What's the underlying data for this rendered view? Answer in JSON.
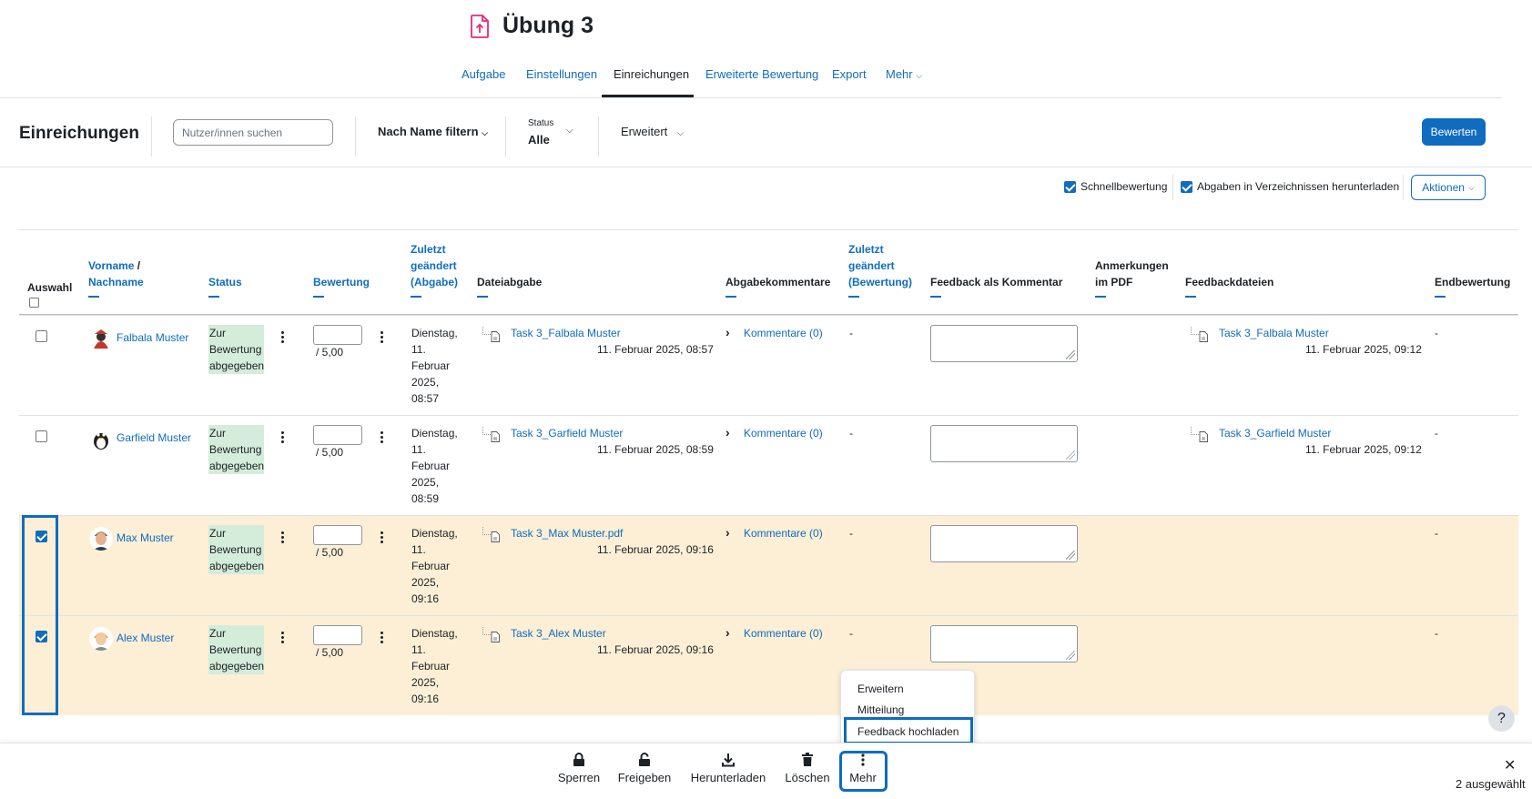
{
  "page": {
    "title": "Übung 3"
  },
  "nav_tabs": [
    "Aufgabe",
    "Einstellungen",
    "Einreichungen",
    "Erweiterte Bewertung",
    "Export",
    "Mehr"
  ],
  "toolbar": {
    "heading": "Einreichungen",
    "search_placeholder": "Nutzer/innen suchen",
    "name_filter": "Nach Name filtern",
    "status_label": "Status",
    "status_value": "Alle",
    "advanced": "Erweitert",
    "grade_button": "Bewerten"
  },
  "options": {
    "quick_grading": "Schnellbewertung",
    "download_in_folders": "Abgaben in Verzeichnissen herunterladen",
    "actions": "Aktionen"
  },
  "table": {
    "headers": {
      "select": "Auswahl",
      "firstname": "Vorname",
      "lastname": "Nachname",
      "status": "Status",
      "grade": "Bewertung",
      "last_modified_submission": [
        "Zuletzt",
        "geändert",
        "(Abgabe)"
      ],
      "file_submission": "Dateiabgabe",
      "submission_comments": "Abgabekommentare",
      "last_modified_grade": [
        "Zuletzt",
        "geändert",
        "(Bewertung)"
      ],
      "feedback_comment": "Feedback als Kommentar",
      "pdf_annotations": [
        "Anmerkungen",
        "im PDF"
      ],
      "feedback_files": "Feedbackdateien",
      "final_grade": "Endbewertung"
    },
    "rows": [
      {
        "name": "Falbala Muster",
        "selected": false,
        "status": [
          "Zur",
          "Bewertung",
          "abgegeben"
        ],
        "grade_outof": "/ 5,00",
        "modified": [
          "Dienstag,",
          "11.",
          "Februar",
          "2025,",
          "08:57"
        ],
        "file_name": "Task 3_Falbala Muster",
        "file_date": "11. Februar 2025, 08:57",
        "comments": "Kommentare (0)",
        "modified_grade": "-",
        "feedback_file": "Task 3_Falbala Muster",
        "feedback_file_date": "11. Februar 2025, 09:12",
        "final_grade": "-"
      },
      {
        "name": "Garfield Muster",
        "selected": false,
        "status": [
          "Zur",
          "Bewertung",
          "abgegeben"
        ],
        "grade_outof": "/ 5,00",
        "modified": [
          "Dienstag,",
          "11.",
          "Februar",
          "2025,",
          "08:59"
        ],
        "file_name": "Task 3_Garfield Muster",
        "file_date": "11. Februar 2025, 08:59",
        "comments": "Kommentare (0)",
        "modified_grade": "-",
        "feedback_file": "Task 3_Garfield Muster",
        "feedback_file_date": "11. Februar 2025, 09:12",
        "final_grade": "-"
      },
      {
        "name": "Max Muster",
        "selected": true,
        "status": [
          "Zur",
          "Bewertung",
          "abgegeben"
        ],
        "grade_outof": "/ 5,00",
        "modified": [
          "Dienstag,",
          "11.",
          "Februar",
          "2025,",
          "09:16"
        ],
        "file_name": "Task 3_Max Muster.pdf",
        "file_date": "11. Februar 2025, 09:16",
        "comments": "Kommentare (0)",
        "modified_grade": "-",
        "feedback_file": "",
        "feedback_file_date": "",
        "final_grade": "-"
      },
      {
        "name": "Alex Muster",
        "selected": true,
        "status": [
          "Zur",
          "Bewertung",
          "abgegeben"
        ],
        "grade_outof": "/ 5,00",
        "modified": [
          "Dienstag,",
          "11.",
          "Februar",
          "2025,",
          "09:16"
        ],
        "file_name": "Task 3_Alex Muster",
        "file_date": "11. Februar 2025, 09:16",
        "comments": "Kommentare (0)",
        "modified_grade": "-",
        "feedback_file": "",
        "feedback_file_date": "",
        "final_grade": "-"
      }
    ]
  },
  "more_menu": [
    "Erweitern",
    "Mitteilung",
    "Feedback hochladen"
  ],
  "bulk_actions": {
    "lock": "Sperren",
    "unlock": "Freigeben",
    "download": "Herunterladen",
    "delete": "Löschen",
    "more": "Mehr",
    "selected_count": "2 ausgewählt",
    "help": "?"
  },
  "colors": {
    "primary": "#0f6cbf",
    "selected_row": "#fcefd6",
    "status_badge": "#d4edda",
    "title_icon": "#e5297c"
  }
}
